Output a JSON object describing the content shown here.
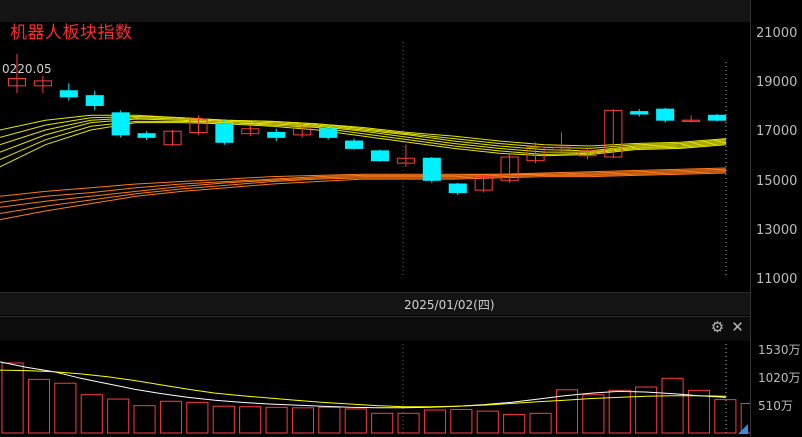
{
  "title": "机器人板块指数",
  "last_price_label": "0220.05",
  "date_label": "2025/01/02(四)",
  "colors": {
    "up": "#ff3b3b",
    "down": "#00f0ff",
    "ma_yellow": "#e6e600",
    "ma_orange": "#ff7a1a",
    "vol_bar": "#ff3b3b",
    "vol_ma1": "#ffffff",
    "vol_ma2": "#ffff00"
  },
  "icons": {
    "settings": "gear-icon",
    "close": "close-icon"
  },
  "chart_data": [
    {
      "type": "candlestick",
      "title": "机器人板块指数",
      "ylim": [
        10500,
        21500
      ],
      "yticks": [
        11000,
        13000,
        15000,
        17000,
        19000,
        21000
      ],
      "highlight_date": "2025/01/02(四)",
      "candles": [
        {
          "o": 18900,
          "c": 19200,
          "h": 20200,
          "l": 18600
        },
        {
          "o": 18900,
          "c": 19100,
          "h": 19300,
          "l": 18600
        },
        {
          "o": 18700,
          "c": 18450,
          "h": 19000,
          "l": 18300
        },
        {
          "o": 18500,
          "c": 18100,
          "h": 18700,
          "l": 17900
        },
        {
          "o": 17800,
          "c": 16900,
          "h": 17900,
          "l": 16800
        },
        {
          "o": 16950,
          "c": 16800,
          "h": 17050,
          "l": 16700
        },
        {
          "o": 16500,
          "c": 17050,
          "h": 17100,
          "l": 16450
        },
        {
          "o": 17000,
          "c": 17550,
          "h": 17700,
          "l": 16900
        },
        {
          "o": 17350,
          "c": 16600,
          "h": 17500,
          "l": 16500
        },
        {
          "o": 16950,
          "c": 17150,
          "h": 17300,
          "l": 16850
        },
        {
          "o": 17000,
          "c": 16800,
          "h": 17150,
          "l": 16650
        },
        {
          "o": 16900,
          "c": 17200,
          "h": 17300,
          "l": 16800
        },
        {
          "o": 17150,
          "c": 16800,
          "h": 17250,
          "l": 16700
        },
        {
          "o": 16650,
          "c": 16350,
          "h": 16750,
          "l": 16300
        },
        {
          "o": 16250,
          "c": 15850,
          "h": 16300,
          "l": 15800
        },
        {
          "o": 15750,
          "c": 15950,
          "h": 16500,
          "l": 15600
        },
        {
          "o": 15950,
          "c": 15050,
          "h": 16000,
          "l": 14950
        },
        {
          "o": 14900,
          "c": 14550,
          "h": 14950,
          "l": 14450
        },
        {
          "o": 14650,
          "c": 15200,
          "h": 15250,
          "l": 14550
        },
        {
          "o": 15050,
          "c": 16000,
          "h": 16150,
          "l": 14950
        },
        {
          "o": 15850,
          "c": 16400,
          "h": 16600,
          "l": 15750
        },
        {
          "o": 16300,
          "c": 16400,
          "h": 17000,
          "l": 16200
        },
        {
          "o": 16050,
          "c": 16250,
          "h": 16400,
          "l": 15900
        },
        {
          "o": 16000,
          "c": 17900,
          "h": 17950,
          "l": 15950
        },
        {
          "o": 17850,
          "c": 17750,
          "h": 17950,
          "l": 17650
        },
        {
          "o": 17950,
          "c": 17500,
          "h": 18000,
          "l": 17400
        },
        {
          "o": 17450,
          "c": 17500,
          "h": 17700,
          "l": 17400
        },
        {
          "o": 17700,
          "c": 17500,
          "h": 17750,
          "l": 17450
        }
      ],
      "ma_yellow": [
        [
          17100,
          17500,
          17700,
          17700,
          17600,
          17500,
          17450,
          17350,
          17200,
          17000,
          16850,
          16650,
          16500,
          16450,
          16550,
          16600,
          16750
        ],
        [
          16800,
          17300,
          17600,
          17650,
          17600,
          17500,
          17450,
          17350,
          17150,
          16950,
          16750,
          16550,
          16400,
          16350,
          16500,
          16550,
          16700
        ],
        [
          16500,
          17100,
          17500,
          17600,
          17550,
          17450,
          17400,
          17300,
          17100,
          16900,
          16650,
          16450,
          16300,
          16250,
          16450,
          16500,
          16650
        ],
        [
          16200,
          16900,
          17400,
          17550,
          17500,
          17400,
          17350,
          17250,
          17050,
          16800,
          16550,
          16350,
          16200,
          16200,
          16400,
          16450,
          16600
        ],
        [
          15900,
          16700,
          17250,
          17450,
          17450,
          17400,
          17300,
          17200,
          16950,
          16700,
          16450,
          16250,
          16100,
          16150,
          16350,
          16400,
          16550
        ],
        [
          15600,
          16500,
          17100,
          17400,
          17400,
          17350,
          17250,
          17100,
          16850,
          16600,
          16350,
          16150,
          16050,
          16100,
          16300,
          16350,
          16500
        ]
      ],
      "ma_orange": [
        [
          14400,
          14600,
          14750,
          14900,
          15000,
          15100,
          15200,
          15250,
          15300,
          15300,
          15300,
          15300,
          15350,
          15400,
          15450,
          15500,
          15550
        ],
        [
          14150,
          14400,
          14550,
          14750,
          14900,
          15000,
          15100,
          15200,
          15250,
          15250,
          15250,
          15300,
          15300,
          15350,
          15400,
          15450,
          15500
        ],
        [
          13950,
          14200,
          14400,
          14600,
          14800,
          14950,
          15050,
          15150,
          15200,
          15200,
          15200,
          15250,
          15300,
          15300,
          15350,
          15400,
          15450
        ],
        [
          13700,
          14000,
          14250,
          14500,
          14700,
          14850,
          15000,
          15100,
          15150,
          15150,
          15150,
          15200,
          15250,
          15250,
          15300,
          15350,
          15400
        ],
        [
          13450,
          13800,
          14100,
          14400,
          14600,
          14750,
          14900,
          15000,
          15100,
          15100,
          15100,
          15150,
          15200,
          15200,
          15250,
          15300,
          15350
        ]
      ]
    },
    {
      "type": "bar",
      "title": "volume",
      "ylim": [
        0,
        1700
      ],
      "yticks": [
        "1530万",
        "1020万",
        "510万"
      ],
      "ytick_values": [
        1530,
        1020,
        510
      ],
      "values": [
        1280,
        980,
        910,
        700,
        620,
        500,
        580,
        560,
        490,
        480,
        470,
        460,
        470,
        440,
        360,
        360,
        420,
        430,
        400,
        340,
        360,
        790,
        700,
        780,
        840,
        1000,
        780,
        610,
        540,
        480
      ],
      "ma1": [
        1300,
        1200,
        1120,
        1000,
        900,
        800,
        720,
        650,
        600,
        560,
        530,
        510,
        490,
        470,
        460,
        460,
        470,
        490,
        520,
        560,
        620,
        680,
        730,
        760,
        750,
        720,
        680,
        650
      ],
      "ma2": [
        1150,
        1140,
        1120,
        1080,
        1030,
        960,
        880,
        800,
        730,
        680,
        640,
        600,
        560,
        530,
        500,
        480,
        480,
        490,
        510,
        540,
        570,
        600,
        630,
        650,
        670,
        680,
        680,
        670
      ]
    }
  ]
}
